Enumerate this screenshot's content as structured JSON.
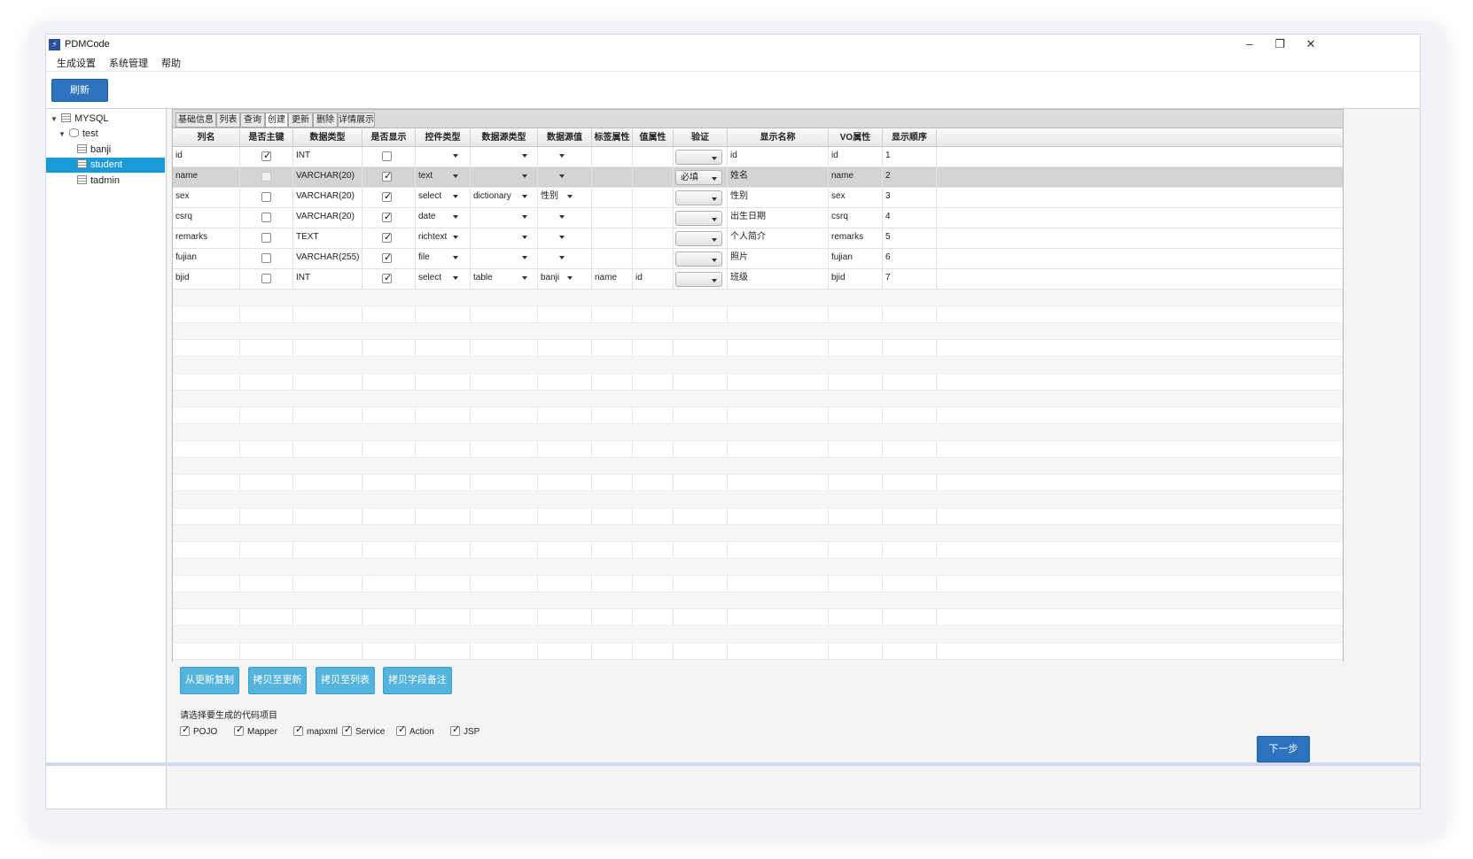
{
  "window": {
    "title": "PDMCode",
    "controls": [
      "minimize",
      "restore",
      "close"
    ]
  },
  "menu": [
    "生成设置",
    "系统管理",
    "帮助"
  ],
  "toolbar": {
    "refresh_label": "刷新"
  },
  "tree": [
    {
      "label": "MYSQL",
      "level": 0,
      "expanded": true,
      "icon": "server-icon"
    },
    {
      "label": "test",
      "level": 1,
      "expanded": true,
      "icon": "database-icon"
    },
    {
      "label": "banji",
      "level": 2,
      "icon": "table-icon"
    },
    {
      "label": "student",
      "level": 2,
      "icon": "table-icon",
      "selected": true
    },
    {
      "label": "tadmin",
      "level": 2,
      "icon": "table-icon"
    }
  ],
  "tabs": [
    "基础信息",
    "列表",
    "查询",
    "创建",
    "更新",
    "删除",
    "详情展示"
  ],
  "active_tab": "创建",
  "columns": [
    "列名",
    "是否主键",
    "数据类型",
    "是否显示",
    "控件类型",
    "数据源类型",
    "数据源值",
    "标签属性",
    "值属性",
    "验证",
    "显示名称",
    "VO属性",
    "显示顺序"
  ],
  "rows": [
    {
      "name": "id",
      "pk": true,
      "pk_disabled": false,
      "type": "INT",
      "show": false,
      "control": "",
      "ds_type": "",
      "ds_value": "",
      "label_attr": "",
      "value_attr": "",
      "validate": "",
      "display": "id",
      "vo": "id",
      "order": "1"
    },
    {
      "name": "name",
      "pk": false,
      "pk_disabled": true,
      "type": "VARCHAR(20)",
      "show": true,
      "control": "text",
      "ds_type": "",
      "ds_value": "",
      "label_attr": "",
      "value_attr": "",
      "validate": "必填",
      "display": "姓名",
      "vo": "name",
      "order": "2",
      "selected": true
    },
    {
      "name": "sex",
      "pk": false,
      "pk_disabled": false,
      "type": "VARCHAR(20)",
      "show": true,
      "control": "select",
      "ds_type": "dictionary",
      "ds_value": "性别",
      "label_attr": "",
      "value_attr": "",
      "validate": "",
      "display": "性别",
      "vo": "sex",
      "order": "3"
    },
    {
      "name": "csrq",
      "pk": false,
      "pk_disabled": false,
      "type": "VARCHAR(20)",
      "show": true,
      "control": "date",
      "ds_type": "",
      "ds_value": "",
      "label_attr": "",
      "value_attr": "",
      "validate": "",
      "display": "出生日期",
      "vo": "csrq",
      "order": "4"
    },
    {
      "name": "remarks",
      "pk": false,
      "pk_disabled": false,
      "type": "TEXT",
      "show": true,
      "control": "richtext",
      "ds_type": "",
      "ds_value": "",
      "label_attr": "",
      "value_attr": "",
      "validate": "",
      "display": "个人简介",
      "vo": "remarks",
      "order": "5"
    },
    {
      "name": "fujian",
      "pk": false,
      "pk_disabled": false,
      "type": "VARCHAR(255)",
      "show": true,
      "control": "file",
      "ds_type": "",
      "ds_value": "",
      "label_attr": "",
      "value_attr": "",
      "validate": "",
      "display": "照片",
      "vo": "fujian",
      "order": "6"
    },
    {
      "name": "bjid",
      "pk": false,
      "pk_disabled": false,
      "type": "INT",
      "show": true,
      "control": "select",
      "ds_type": "table",
      "ds_value": "banji",
      "label_attr": "name",
      "value_attr": "id",
      "validate": "",
      "display": "班级",
      "vo": "bjid",
      "order": "7"
    }
  ],
  "actions": [
    "从更新复制",
    "拷贝至更新",
    "拷贝至列表",
    "拷贝字段备注"
  ],
  "project_prompt": "请选择要生成的代码项目",
  "projects": [
    {
      "label": "POJO",
      "checked": true
    },
    {
      "label": "Mapper",
      "checked": true
    },
    {
      "label": "mapxml",
      "checked": true
    },
    {
      "label": "Service",
      "checked": true
    },
    {
      "label": "Action",
      "checked": true
    },
    {
      "label": "JSP",
      "checked": true
    }
  ],
  "next_label": "下一步"
}
